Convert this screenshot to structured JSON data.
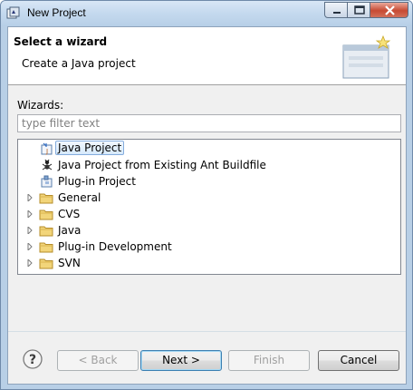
{
  "window": {
    "title": "New Project",
    "icon": "eclipse-new-project-icon"
  },
  "header": {
    "title": "Select a wizard",
    "description": "Create a Java project",
    "banner_icon": "wizard-banner-icon"
  },
  "wizards": {
    "label": "Wizards:",
    "filter_placeholder": "type filter text",
    "filter_value": ""
  },
  "tree": {
    "items": [
      {
        "label": "Java Project",
        "icon": "java-project-icon",
        "expandable": false,
        "selected": true
      },
      {
        "label": "Java Project from Existing Ant Buildfile",
        "icon": "ant-icon",
        "expandable": false,
        "selected": false
      },
      {
        "label": "Plug-in Project",
        "icon": "plugin-project-icon",
        "expandable": false,
        "selected": false
      },
      {
        "label": "General",
        "icon": "folder-icon",
        "expandable": true,
        "selected": false
      },
      {
        "label": "CVS",
        "icon": "folder-icon",
        "expandable": true,
        "selected": false
      },
      {
        "label": "Java",
        "icon": "folder-icon",
        "expandable": true,
        "selected": false
      },
      {
        "label": "Plug-in Development",
        "icon": "folder-icon",
        "expandable": true,
        "selected": false
      },
      {
        "label": "SVN",
        "icon": "folder-icon",
        "expandable": true,
        "selected": false
      }
    ]
  },
  "buttons": {
    "back": "< Back",
    "next": "Next >",
    "finish": "Finish",
    "cancel": "Cancel"
  },
  "colors": {
    "titlebar": "#c4d9ee",
    "client_bg": "#f0f0f0",
    "close_button": "#c74a33",
    "selection": "#d6e9fc",
    "folder": "#e8c35a"
  }
}
